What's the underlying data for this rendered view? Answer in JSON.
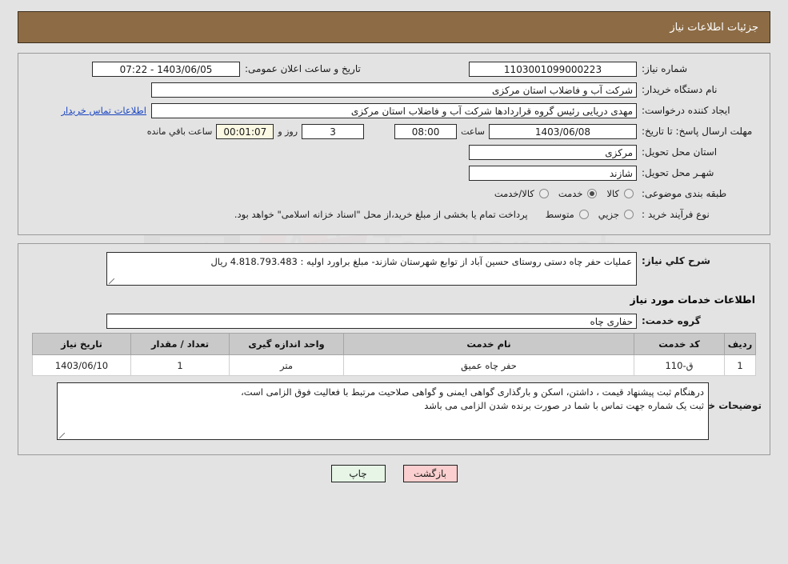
{
  "header": {
    "title": "جزئیات اطلاعات نیاز"
  },
  "form": {
    "need_number_label": "شماره نیاز:",
    "need_number_value": "1103001099000223",
    "announce_label": "تاریخ و ساعت اعلان عمومی:",
    "announce_value": "1403/06/05 - 07:22",
    "buyer_org_label": "نام دستگاه خریدار:",
    "buyer_org_value": "شرکت آب و فاضلاب استان مرکزی",
    "requester_label": "ایجاد کننده درخواست:",
    "requester_value": "مهدی دریایی رئیس گروه قراردادها شرکت آب و فاضلاب استان مرکزی",
    "contact_link": "اطلاعات تماس خریدار",
    "deadline_label": "مهلت ارسال پاسخ: تا تاریخ:",
    "deadline_date": "1403/06/08",
    "hour_label": "ساعت",
    "deadline_time": "08:00",
    "days_value": "3",
    "days_word": "روز و",
    "countdown_value": "00:01:07",
    "remaining_label": "ساعت باقي مانده",
    "province_label": "استان محل تحویل:",
    "province_value": "مرکزی",
    "city_label": "شهـر محل تحویل:",
    "city_value": "شازند",
    "category_label": "طبقه بندی موضوعی:",
    "category_options": [
      {
        "label": "کالا",
        "selected": false
      },
      {
        "label": "خدمت",
        "selected": true
      },
      {
        "label": "کالا/خدمت",
        "selected": false
      }
    ],
    "process_label": "نوع فرآیند خرید :",
    "process_options": [
      {
        "label": "جزیي",
        "selected": false
      },
      {
        "label": "متوسط",
        "selected": false
      }
    ],
    "treasury_note": "پرداخت تمام یا بخشی از مبلغ خرید،از محل \"اسناد خزانه اسلامی\" خواهد بود."
  },
  "description": {
    "label": "شرح كلي نياز:",
    "value": "عملیات حفر چاه دستی روستای حسین آباد از توابع شهرستان شازند- مبلغ براورد اولیه : 4.818.793.483 ریال"
  },
  "services": {
    "heading": "اطلاعات خدمات مورد نیاز",
    "group_label": "گروه خدمت:",
    "group_value": "حفاری چاه",
    "columns": [
      "ردیف",
      "کد خدمت",
      "نام خدمت",
      "واحد اندازه گیری",
      "تعداد / مقدار",
      "تاریخ نیاز"
    ],
    "rows": [
      {
        "index": "1",
        "code": "ق-110",
        "name": "حفر چاه عمیق",
        "unit": "متر",
        "quantity": "1",
        "date": "1403/06/10"
      }
    ]
  },
  "buyer_notes": {
    "label": "توضیحات خریدار:",
    "line1": "درهنگام ثبت پیشنهاد قیمت ، داشتن، اسکن و بارگذاری گواهی ایمنی و گواهی صلاحیت مرتبط با فعالیت فوق الزامی است،",
    "line2": "ثبت یک شماره جهت تماس با شما در صورت برنده شدن الزامی می باشد"
  },
  "buttons": {
    "print": "چاپ",
    "back": "بازگشت"
  },
  "colors": {
    "header_bg": "#8d6c45",
    "page_bg": "#e3e3e3",
    "link": "#1b46c2",
    "print_bg": "#e6f5e6",
    "back_bg": "#fbcfcf",
    "countdown_bg": "#fbf8e3"
  },
  "watermark": {
    "text": "AriaTender.net"
  }
}
